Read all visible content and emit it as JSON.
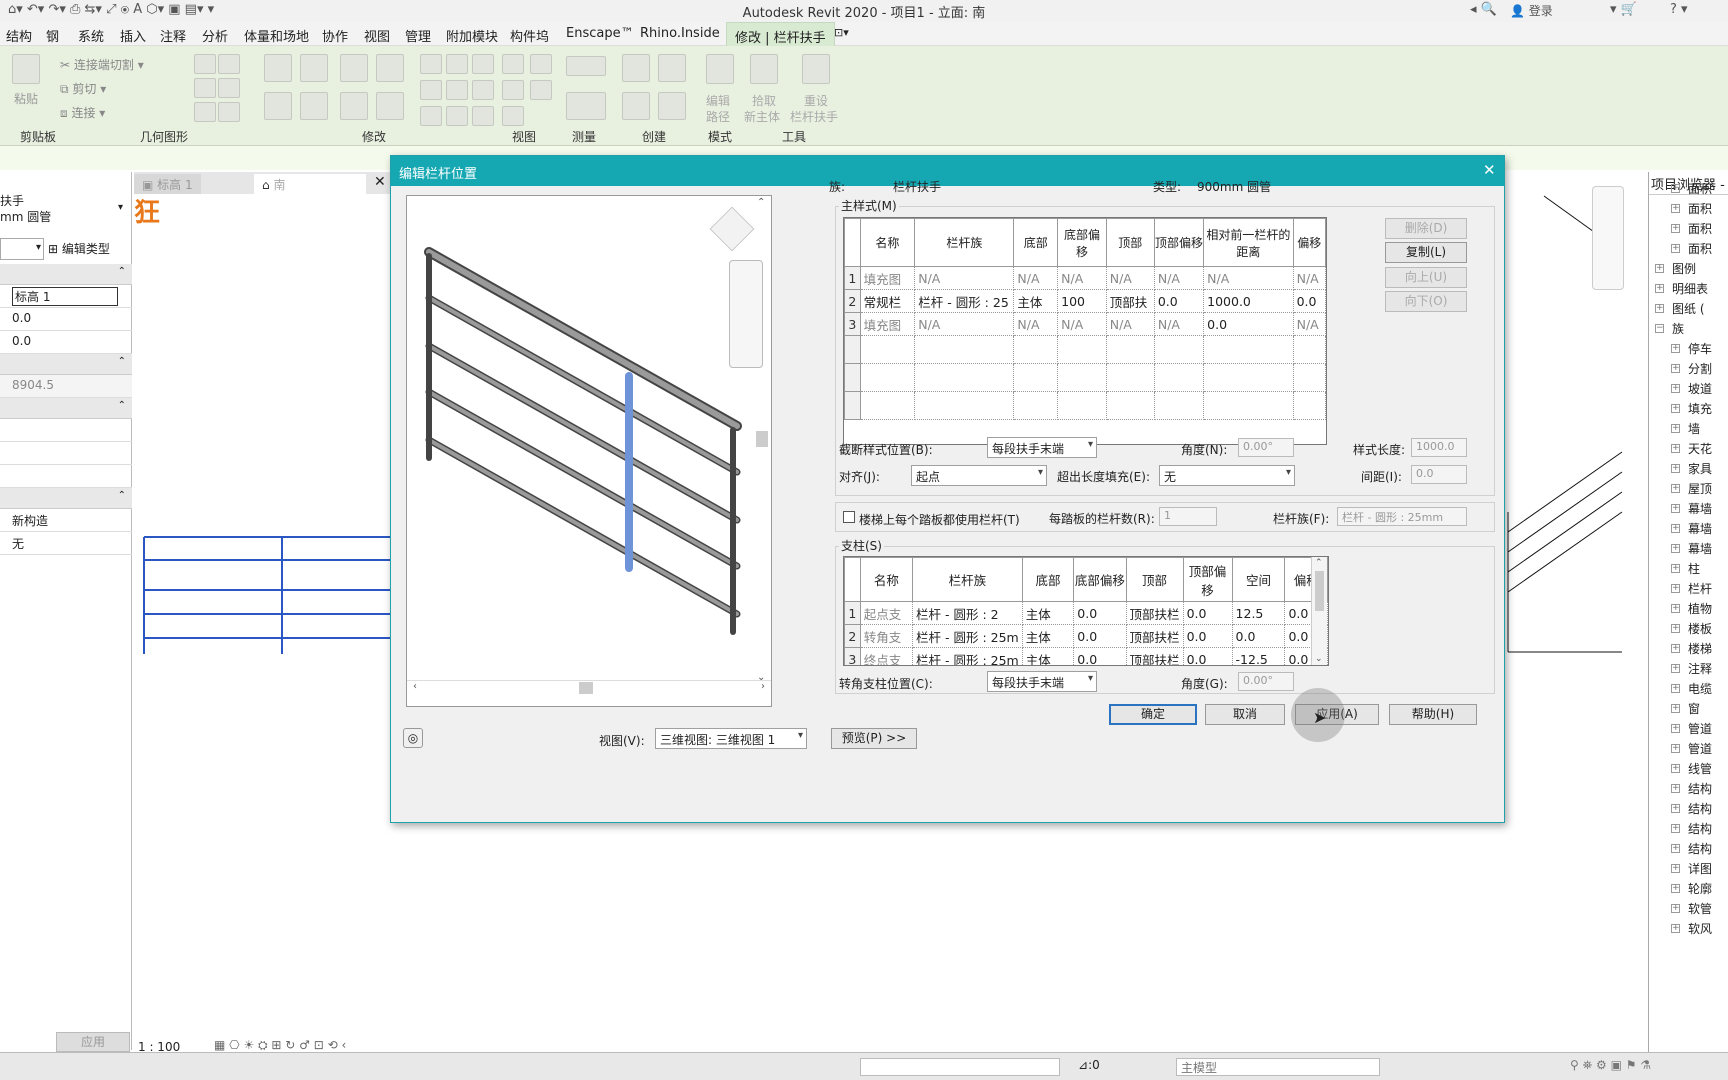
{
  "app": {
    "title": "Autodesk Revit 2020 - 项目1 - 立面: 南",
    "login": "登录"
  },
  "menu": [
    "结构",
    "钢",
    "系统",
    "插入",
    "注释",
    "分析",
    "体量和场地",
    "协作",
    "视图",
    "管理",
    "附加模块",
    "构件坞",
    "Enscape™",
    "Rhino.Inside",
    "修改 | 栏杆扶手"
  ],
  "ribbon": {
    "paste": "粘贴",
    "connect_cut": "连接端切割",
    "cut": "剪切",
    "join": "连接",
    "edit_path_1": "编辑",
    "edit_path_2": "路径",
    "pick_1": "拾取",
    "pick_2": "新主体",
    "reset_1": "重设",
    "reset_2": "栏杆扶手",
    "groups": [
      "剪贴板",
      "几何图形",
      "修改",
      "视图",
      "测量",
      "创建",
      "模式",
      "工具"
    ]
  },
  "props": {
    "type_line1": "扶手",
    "type_line2": "mm 圆管",
    "edit_type": "编辑类型",
    "level": "标高 1",
    "v1": "0.0",
    "v2": "0.0",
    "v3": "8904.5",
    "phase": "新构造",
    "none": "无",
    "apply": "应用"
  },
  "view": {
    "tab1": "标高 1",
    "tab2": "南",
    "scale": "1 : 100"
  },
  "browser": {
    "title": "项目浏览器 -",
    "items": [
      "面积",
      "面积",
      "面积",
      "面积",
      "图例",
      "明细表",
      "图纸 (",
      "族",
      "停车",
      "分割",
      "坡道",
      "填充",
      "墙",
      "天花",
      "家具",
      "屋顶",
      "幕墙",
      "幕墙",
      "幕墙",
      "柱",
      "栏杆",
      "植物",
      "楼板",
      "楼梯",
      "注释",
      "电缆",
      "窗",
      "管道",
      "管道",
      "线管",
      "结构",
      "结构",
      "结构",
      "结构",
      "详图",
      "轮廓",
      "软管",
      "软风"
    ]
  },
  "status": {
    "zero": ":0",
    "model": "主模型"
  },
  "dialog": {
    "title": "编辑栏杆位置",
    "family_label": "族:",
    "family": "栏杆扶手",
    "type_label": "类型:",
    "type": "900mm 圆管",
    "main_pattern": "主样式(M)",
    "main_headers": [
      "名称",
      "栏杆族",
      "底部",
      "底部偏移",
      "顶部",
      "顶部偏移",
      "相对前一栏杆的距离",
      "偏移"
    ],
    "main_rows": [
      [
        "1",
        "填充图",
        "N/A",
        "N/A",
        "N/A",
        "N/A",
        "N/A",
        "N/A",
        "N/A"
      ],
      [
        "2",
        "常规栏",
        "栏杆 - 圆形 : 25",
        "主体",
        "100",
        "顶部扶",
        "0.0",
        "1000.0",
        "0.0"
      ],
      [
        "3",
        "填充图",
        "N/A",
        "N/A",
        "N/A",
        "N/A",
        "N/A",
        "0.0",
        "N/A"
      ]
    ],
    "side_buttons": [
      "删除(D)",
      "复制(L)",
      "向上(U)",
      "向下(O)"
    ],
    "break_label": "截断样式位置(B):",
    "break_value": "每段扶手末端",
    "angle_label": "角度(N):",
    "angle_value": "0.00°",
    "pattern_len_label": "样式长度:",
    "pattern_len_value": "1000.0",
    "justify_label": "对齐(J):",
    "justify_value": "起点",
    "excess_label": "超出长度填充(E):",
    "excess_value": "无",
    "spacing_label": "间距(I):",
    "spacing_value": "0.0",
    "per_tread_label": "楼梯上每个踏板都使用栏杆(T)",
    "per_tread_count_label": "每踏板的栏杆数(R):",
    "per_tread_count": "1",
    "baluster_family_label": "栏杆族(F):",
    "baluster_family": "栏杆 - 圆形 : 25mm",
    "posts_label": "支柱(S)",
    "post_headers": [
      "名称",
      "栏杆族",
      "底部",
      "底部偏移",
      "顶部",
      "顶部偏移",
      "空间",
      "偏移"
    ],
    "post_rows": [
      [
        "1",
        "起点支",
        "栏杆 - 圆形 : 2",
        "主体",
        "0.0",
        "顶部扶栏",
        "0.0",
        "12.5",
        "0.0"
      ],
      [
        "2",
        "转角支",
        "栏杆 - 圆形 : 25m",
        "主体",
        "0.0",
        "顶部扶栏",
        "0.0",
        "0.0",
        "0.0"
      ],
      [
        "3",
        "终点支",
        "栏杆 - 圆形 : 25m",
        "主体",
        "0.0",
        "顶部扶栏",
        "0.0",
        "-12.5",
        "0.0"
      ]
    ],
    "corner_label": "转角支柱位置(C):",
    "corner_value": "每段扶手末端",
    "corner_angle_label": "角度(G):",
    "corner_angle_value": "0.00°",
    "view_label": "视图(V):",
    "view_value": "三维视图: 三维视图 1",
    "preview_btn": "预览(P) >>",
    "ok": "确定",
    "cancel": "取消",
    "apply": "应用(A)",
    "help": "帮助(H)"
  }
}
